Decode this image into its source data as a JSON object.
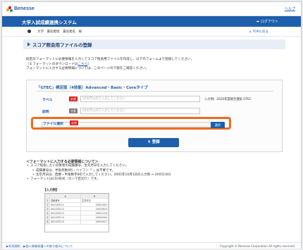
{
  "brand": {
    "name": "Benesse",
    "help_label": "ヘルプ"
  },
  "header": {
    "title": "大学入試成績連携システム",
    "logout_label": "ログアウト"
  },
  "user": {
    "name": "大学　責任者姓　責任者名　様",
    "top_label": "TOPに戻る"
  },
  "page": {
    "title": "スコア照会用ファイルの登録"
  },
  "intro": {
    "line1": "既定のフォーマットに必要情報を入力してスコア照会用ファイルを作成し、以下のフォームより登録してください。",
    "line2_prefix": "（Ｅフォーマットのダウンロードは",
    "line2_link": "こちら",
    "line2_suffix": "）",
    "line3": "フォーマットに入力する必要情報については、このページの下部をご確認ください。"
  },
  "form": {
    "section_title": "「GTEC」検定版（4技能）Advanced・Basic・Coreタイプ",
    "label_field": {
      "label": "ラベル",
      "badge": "必須",
      "placeholder": "20文字以内で入力してください",
      "note": "入力例）2020年度総合選抜 GTEC"
    },
    "desc_field": {
      "label": "説明",
      "badge": "任意",
      "placeholder": "40文字以内で入力してください"
    },
    "file_field": {
      "label": "ファイル選択",
      "badge": "必須",
      "browse_label": "選択"
    },
    "submit_label": "登録"
  },
  "format": {
    "heading": "＜フォーマットに入力する必要情報について＞",
    "items": [
      "スコア照会したい対象者の成績番号、生年月日を入力してください。",
      "成績番号は、半角英数9桁・ハイフン「-」は不要です。",
      "生年月日は、西暦・半角数字8桁で入力してください。2005年10月1日の入力例 ⇒ 20051001",
      "フォーマットはCSV形式（カンマ区切り）です。"
    ],
    "example_title": "【入力例】"
  },
  "sheet": {
    "columns": [
      "",
      "A",
      "B"
    ],
    "rows": [
      [
        "1",
        "成績番号",
        "生年月日"
      ],
      [
        "2",
        "XX11ZZ111",
        "20011001"
      ],
      [
        "3",
        "XX11ZZ112",
        "20010913"
      ],
      [
        "4",
        "XX11ZZ113",
        "20011120"
      ],
      [
        "5",
        "XX11ZZ114",
        "20020304"
      ],
      [
        "6",
        "XX11ZZ115",
        "20010417"
      ]
    ]
  },
  "footer": {
    "links": "▶利用規約　▶個人情報保護への取り組みについて",
    "copyright": "Copyright © Benesse Corporation All rights reserved."
  },
  "colors": {
    "primary": "#1d5fac",
    "highlight": "#f26a1b",
    "required": "#d9221c"
  }
}
